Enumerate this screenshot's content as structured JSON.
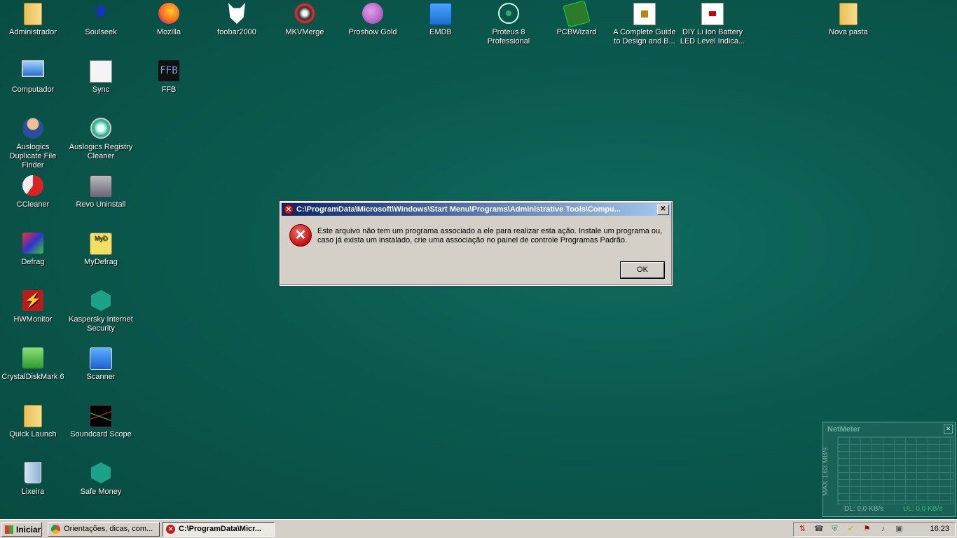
{
  "desktop": {
    "icons": [
      {
        "label": "Administrador",
        "icon": "user-folder-icon"
      },
      {
        "label": "Soulseek",
        "icon": "soulseek-bird-icon"
      },
      {
        "label": "Mozilla",
        "icon": "firefox-icon"
      },
      {
        "label": "foobar2000",
        "icon": "foobar-fox-icon"
      },
      {
        "label": "MKVMerge",
        "icon": "mkvmerge-icon"
      },
      {
        "label": "Proshow Gold",
        "icon": "proshow-icon"
      },
      {
        "label": "EMDB",
        "icon": "emdb-clapper-icon"
      },
      {
        "label": "Proteus 8 Professional",
        "icon": "proteus-atom-icon"
      },
      {
        "label": "PCBWizard",
        "icon": "pcb-board-icon"
      },
      {
        "label": "A Complete Guide to Design and B...",
        "icon": "video-file-icon"
      },
      {
        "label": "DIY Li Ion Battery LED Level Indica...",
        "icon": "video-file-icon"
      },
      {
        "label": "Nova pasta",
        "icon": "folder-icon"
      },
      {
        "label": "Computador",
        "icon": "computer-icon"
      },
      {
        "label": "Sync",
        "icon": "sync-icon"
      },
      {
        "label": "FFB",
        "icon": "ffb-icon"
      },
      {
        "label": "Auslogics Duplicate File Finder",
        "icon": "auslogics-duplicate-icon"
      },
      {
        "label": "Auslogics Registry Cleaner",
        "icon": "auslogics-registry-icon"
      },
      {
        "label": "CCleaner",
        "icon": "ccleaner-icon"
      },
      {
        "label": "Revo Uninstall",
        "icon": "revo-uninstaller-icon"
      },
      {
        "label": "Defrag",
        "icon": "defrag-icon"
      },
      {
        "label": "MyDefrag",
        "icon": "mydefrag-icon"
      },
      {
        "label": "HWMonitor",
        "icon": "hwmonitor-icon"
      },
      {
        "label": "Kaspersky Internet Security",
        "icon": "kaspersky-icon"
      },
      {
        "label": "CrystalDiskMark 6",
        "icon": "crystaldiskmark-icon"
      },
      {
        "label": "Scanner",
        "icon": "scanner-icon"
      },
      {
        "label": "Quick Launch",
        "icon": "folder-icon"
      },
      {
        "label": "Soundcard Scope",
        "icon": "oscilloscope-icon"
      },
      {
        "label": "Lixeira",
        "icon": "recycle-bin-icon"
      },
      {
        "label": "Safe Money",
        "icon": "safe-money-icon"
      }
    ]
  },
  "dialog": {
    "title": "C:\\ProgramData\\Microsoft\\Windows\\Start Menu\\Programs\\Administrative Tools\\Compu...",
    "message": "Este arquivo não tem um programa associado a ele para realizar esta ação. Instale um programa ou, caso já exista um instalado, crie uma associação no painel de controle Programas Padrão.",
    "ok_label": "OK",
    "close_glyph": "✕"
  },
  "netmeter": {
    "title": "NetMeter",
    "max_label": "MAX 1,63 MB/s",
    "dl_label": "DL: 0,0 KB/s",
    "ul_label": "UL: 0,0 KB/s",
    "close_glyph": "✕"
  },
  "taskbar": {
    "start_label": "Iniciar",
    "tasks": [
      {
        "label": "Orientações, dicas, com...",
        "icon": "chrome-icon"
      },
      {
        "label": "C:\\ProgramData\\Micr...",
        "icon": "error-icon"
      }
    ],
    "clock": "16:23"
  }
}
